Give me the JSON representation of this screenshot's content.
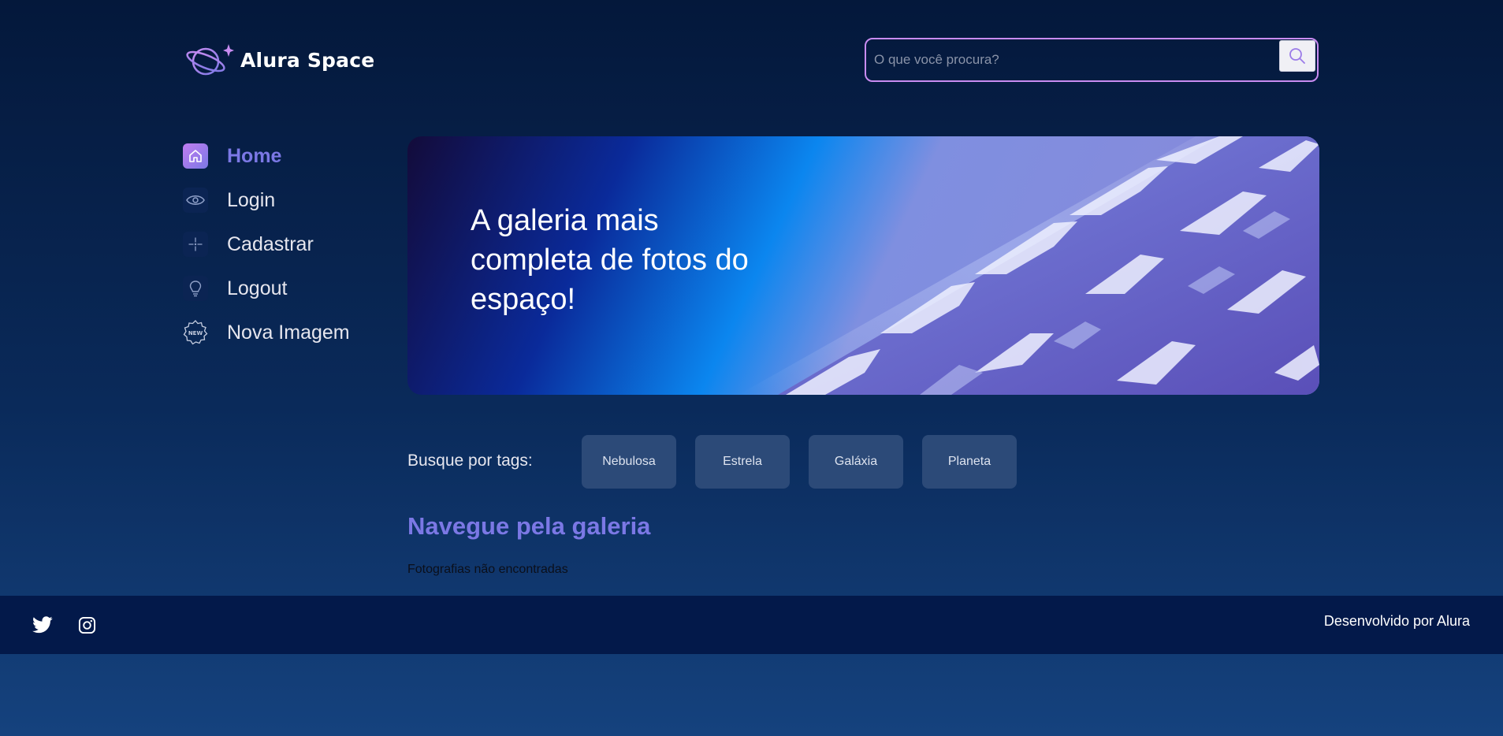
{
  "header": {
    "logo_text": "Alura Space",
    "search": {
      "placeholder": "O que você procura?",
      "value": ""
    }
  },
  "sidebar": {
    "items": [
      {
        "label": "Home",
        "icon": "home-icon",
        "active": true
      },
      {
        "label": "Login",
        "icon": "eye-icon",
        "active": false
      },
      {
        "label": "Cadastrar",
        "icon": "sparkle-icon",
        "active": false
      },
      {
        "label": "Logout",
        "icon": "lightbulb-icon",
        "active": false
      },
      {
        "label": "Nova Imagem",
        "icon": "new-badge-icon",
        "active": false
      }
    ]
  },
  "banner": {
    "title": "A galeria mais completa de fotos do espaço!"
  },
  "tags": {
    "label": "Busque por tags:",
    "items": [
      "Nebulosa",
      "Estrela",
      "Galáxia",
      "Planeta"
    ]
  },
  "gallery": {
    "title": "Navegue pela galeria",
    "empty_message": "Fotografias não encontradas"
  },
  "footer": {
    "credit": "Desenvolvido por Alura",
    "social": [
      "twitter-icon",
      "instagram-icon"
    ]
  },
  "colors": {
    "accent": "#7b78e5",
    "accent_pink": "#c98cf1",
    "tag_bg": "#2c4a78",
    "footer_bg": "#03194a"
  }
}
